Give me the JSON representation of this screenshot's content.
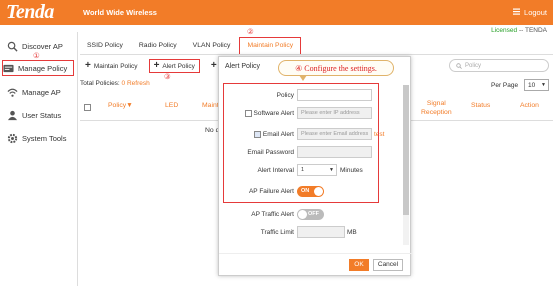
{
  "topbar": {
    "brand": "Tenda",
    "tagline": "World Wide Wireless",
    "menu_icon": "menu-icon",
    "logout_label": "Logout"
  },
  "license": {
    "status": "Licensed",
    "sep": " -- ",
    "owner": "TENDA"
  },
  "sidebar": {
    "items": [
      {
        "label": "Discover AP",
        "icon": "discover-icon"
      },
      {
        "label": "Manage Policy",
        "icon": "policy-icon"
      },
      {
        "label": "Manage AP",
        "icon": "wifi-icon"
      },
      {
        "label": "User Status",
        "icon": "user-icon"
      },
      {
        "label": "System Tools",
        "icon": "gear-icon"
      }
    ],
    "marker": "①"
  },
  "tabs": {
    "items": [
      "SSID Policy",
      "Radio Policy",
      "VLAN Policy",
      "Maintain Policy"
    ],
    "marker": "②"
  },
  "toolbar": {
    "maintain_label": "Maintain Policy",
    "alert_label": "Alert Policy",
    "add_label": "A",
    "marker": "③"
  },
  "list": {
    "total_label": "Total Policies: ",
    "total_value": "0",
    "refresh_label": "Refresh",
    "search_placeholder": "Policy",
    "per_page_label": "Per Page",
    "per_page_value": "10",
    "columns": {
      "policy": "Policy▼",
      "led": "LED",
      "maint": "Maint",
      "signal_line1": "Signal",
      "signal_line2": "Reception",
      "status": "Status",
      "action": "Action"
    },
    "nodata": "No d"
  },
  "modal": {
    "title": "Alert Policy",
    "callout": "④ Configure the settings.",
    "fields": {
      "policy_label": "Policy",
      "policy_value": "",
      "software_label": "Software Alert",
      "software_placeholder": "Please enter IP address",
      "email_label": "Email Alert",
      "email_placeholder": "Please enter Email address",
      "email_test": "test",
      "email_pwd_label": "Email Password",
      "interval_label": "Alert Interval",
      "interval_value": "1",
      "interval_unit": "Minutes",
      "apfail_label": "AP Failure Alert",
      "apfail_state": "ON",
      "traffic_label": "AP Traffic Alert",
      "traffic_state": "OFF",
      "limit_label": "Traffic Limit",
      "limit_unit": "MB"
    },
    "ok_label": "OK",
    "cancel_label": "Cancel"
  },
  "colors": {
    "brand": "#f27c28",
    "annotation_red": "#e53a3a",
    "license_green": "#2aa12a"
  }
}
